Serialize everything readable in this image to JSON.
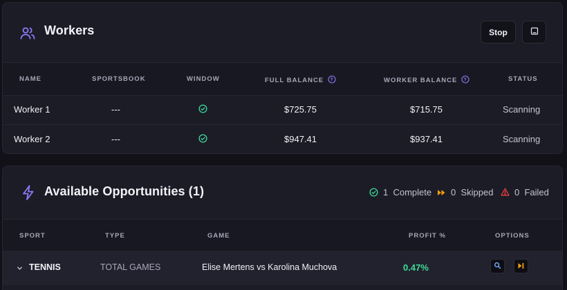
{
  "workers": {
    "title": "Workers",
    "stop_label": "Stop",
    "icons": {
      "header": "users-icon",
      "action": "image-icon"
    },
    "columns": [
      "NAME",
      "SPORTSBOOK",
      "WINDOW",
      "FULL BALANCE",
      "WORKER BALANCE",
      "STATUS"
    ],
    "rows": [
      {
        "name": "Worker 1",
        "sportsbook": "---",
        "window_ok": true,
        "full_balance": "$725.75",
        "worker_balance": "$715.75",
        "status": "Scanning"
      },
      {
        "name": "Worker 2",
        "sportsbook": "---",
        "window_ok": true,
        "full_balance": "$947.41",
        "worker_balance": "$937.41",
        "status": "Scanning"
      }
    ]
  },
  "opportunities": {
    "title": "Available Opportunities (1)",
    "icons": {
      "header": "lightning-icon"
    },
    "stats": {
      "complete_count": "1",
      "complete_label": "Complete",
      "skipped_count": "0",
      "skipped_label": "Skipped",
      "failed_count": "0",
      "failed_label": "Failed"
    },
    "columns": [
      "SPORT",
      "TYPE",
      "GAME",
      "PROFIT %",
      "OPTIONS"
    ],
    "rows": [
      {
        "sport": "TENNIS",
        "type": "TOTAL GAMES",
        "game": "Elise Mertens vs Karolina Muchova",
        "profit": "0.47%"
      }
    ]
  },
  "colors": {
    "accent_purple": "#8b7cf6",
    "success": "#3ddc97",
    "warning": "#f59e0b",
    "danger": "#ef4444"
  }
}
